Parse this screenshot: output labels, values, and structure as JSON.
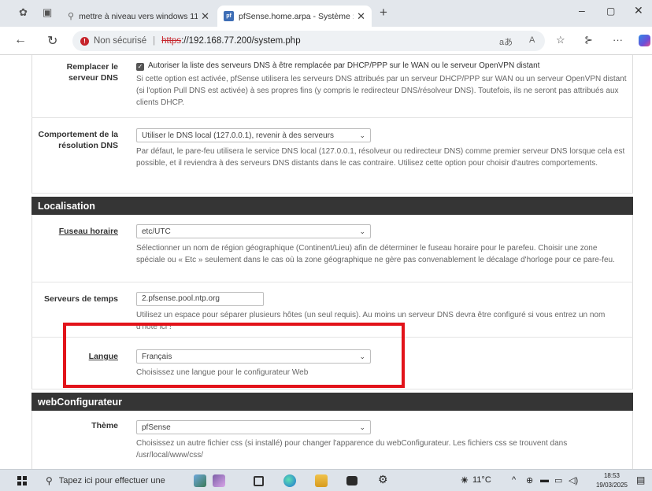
{
  "browser": {
    "tabs": [
      {
        "title": "mettre à niveau vers windows 11",
        "active": false
      },
      {
        "title": "pfSense.home.arpa - Système : G",
        "active": true
      }
    ],
    "icons": {
      "new_tab": "+",
      "minimize": "–",
      "maximize": "▢",
      "close": "✕",
      "back": "←",
      "reload": "↻",
      "read_aloud": "aあ",
      "reader": "A",
      "favorites": "☆",
      "collections": "⊱",
      "more": "···"
    },
    "address": {
      "security_label": "Non sécurisé",
      "scheme": "https",
      "rest": "://192.168.77.200/system.php"
    }
  },
  "dns": {
    "override": {
      "label_line1": "Remplacer le",
      "label_line2": "serveur DNS",
      "checkbox_label": "Autoriser la liste des serveurs DNS à être remplacée par DHCP/PPP sur le WAN ou le serveur OpenVPN distant",
      "checked": true,
      "help": "Si cette option est activée, pfSense utilisera les serveurs DNS attribués par un serveur DHCP/PPP sur WAN ou un serveur OpenVPN distant (si l'option Pull DNS est activée) à ses propres fins (y compris le redirecteur DNS/résolveur DNS). Toutefois, ils ne seront pas attribués aux clients DHCP."
    },
    "resolution": {
      "label_line1": "Comportement de la",
      "label_line2": "résolution DNS",
      "selected": "Utiliser le DNS local (127.0.0.1), revenir à des serveurs",
      "help": "Par défaut, le pare-feu utilisera le service DNS local (127.0.0.1, résolveur ou redirecteur DNS) comme premier serveur DNS lorsque cela est possible, et il reviendra à des serveurs DNS distants dans le cas contraire. Utilisez cette option pour choisir d'autres comportements."
    }
  },
  "localisation": {
    "header": "Localisation",
    "timezone": {
      "label": "Fuseau horaire",
      "selected": "etc/UTC",
      "help": "Sélectionner un nom de région géographique (Continent/Lieu) afin de déterminer le fuseau horaire pour le parefeu. Choisir une zone spéciale ou « Etc » seulement dans le cas où la zone géographique ne gère pas convenablement le décalage d'horloge pour ce pare-feu."
    },
    "timeservers": {
      "label": "Serveurs de temps",
      "value": "2.pfsense.pool.ntp.org",
      "help": "Utilisez un espace pour séparer plusieurs hôtes (un seul requis). Au moins un serveur DNS devra être configuré si vous entrez un nom d'hôte ici !"
    },
    "language": {
      "label": "Langue",
      "selected": "Français",
      "help": "Choisissez une langue pour le configurateur Web"
    }
  },
  "webconfig": {
    "header": "webConfigurateur",
    "theme": {
      "label": "Thème",
      "selected": "pfSense",
      "help": "Choisissez un autre fichier css (si installé) pour changer l'apparence du webConfigurateur. Les fichiers css se trouvent dans /usr/local/www/css/"
    }
  },
  "taskbar": {
    "search_placeholder": "Tapez ici pour effectuer une",
    "weather": "11°C",
    "time": "18:53",
    "date": "19/03/2025"
  }
}
